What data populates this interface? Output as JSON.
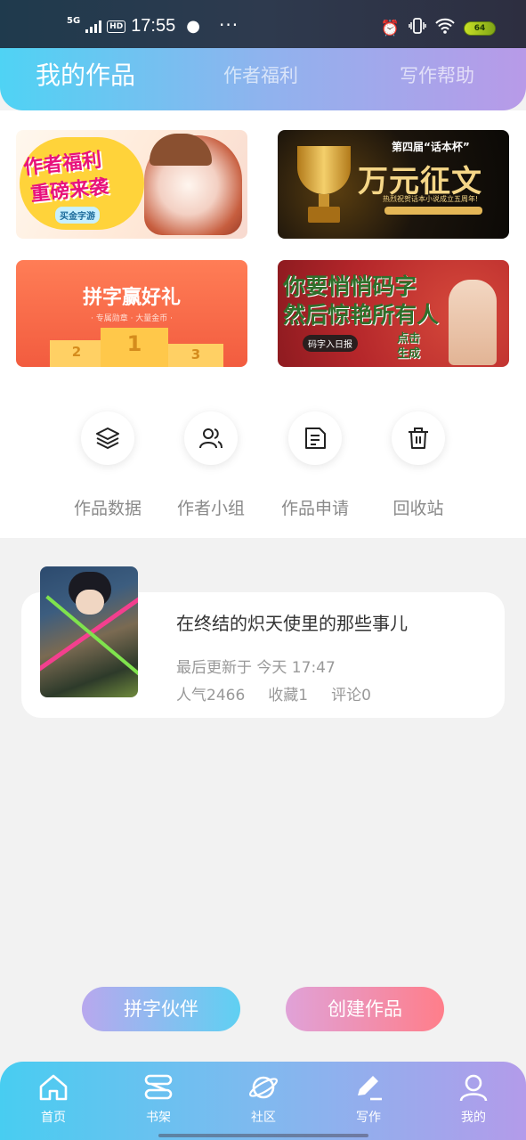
{
  "status_bar": {
    "network": "5G",
    "hd": "HD",
    "time": "17:55",
    "more": "···",
    "battery": "64"
  },
  "header_tabs": [
    {
      "label": "我的作品",
      "active": true
    },
    {
      "label": "作者福利",
      "active": false
    },
    {
      "label": "写作帮助",
      "active": false
    }
  ],
  "banners": {
    "welfare": {
      "line1": "作者福利",
      "line2": "重磅来袭",
      "logo": "买金字游"
    },
    "contest": {
      "small_title": "第四届“话本杯”",
      "title": "万元征文",
      "sub": "热烈祝贺话本小说成立五周年!"
    },
    "pinzi": {
      "title": "拼字赢好礼",
      "sub": "· 专属勋章 · 大量金币 ·",
      "rank1": "1",
      "rank2": "2",
      "rank3": "3"
    },
    "code": {
      "line1": "你要悄悄码字",
      "line2": "然后惊艳所有人",
      "tag": "码字入日报",
      "click": "点击生成"
    }
  },
  "actions": [
    {
      "label": "作品数据",
      "icon": "layers-icon"
    },
    {
      "label": "作者小组",
      "icon": "group-icon"
    },
    {
      "label": "作品申请",
      "icon": "document-icon"
    },
    {
      "label": "回收站",
      "icon": "trash-icon"
    }
  ],
  "work": {
    "title": "在终结的炽天使里的那些事儿",
    "updated": "最后更新于 今天 17:47",
    "popularity": "人气2466",
    "favorites": "收藏1",
    "comments": "评论0"
  },
  "buttons": {
    "partner": "拼字伙伴",
    "create": "创建作品"
  },
  "bottom_nav": [
    {
      "label": "首页",
      "icon": "home-icon"
    },
    {
      "label": "书架",
      "icon": "bookshelf-icon"
    },
    {
      "label": "社区",
      "icon": "planet-icon"
    },
    {
      "label": "写作",
      "icon": "pen-icon"
    },
    {
      "label": "我的",
      "icon": "user-icon"
    }
  ],
  "colors": {
    "header_gradient_start": "#4fd3f4",
    "header_gradient_end": "#b89ae8",
    "partner_gradient": [
      "#b8a8ee",
      "#5fd0f2"
    ],
    "create_gradient": [
      "#e0a2d8",
      "#ff7e8a"
    ]
  }
}
